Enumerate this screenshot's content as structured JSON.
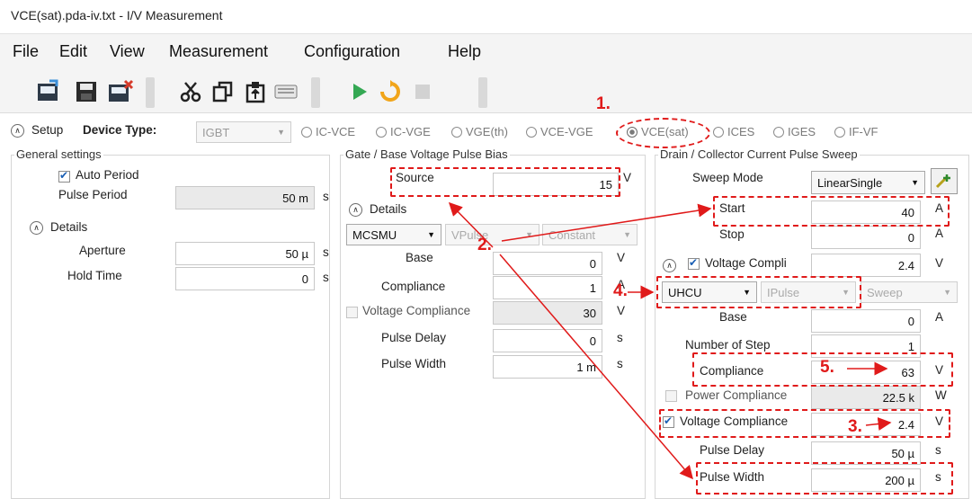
{
  "window": {
    "title": "VCE(sat).pda-iv.txt - I/V Measurement"
  },
  "menu": [
    "File",
    "Edit",
    "View",
    "Measurement",
    "Configuration",
    "Help"
  ],
  "toolbar": {
    "icons": [
      "open-icon",
      "save-icon",
      "new-icon",
      "cut-icon",
      "copy-icon",
      "paste-icon",
      "keyboard-icon",
      "run-icon",
      "repeat-icon",
      "stop-icon"
    ]
  },
  "setup": {
    "label": "Setup",
    "device_type_label": "Device Type:",
    "device_type_value": "IGBT",
    "modes": [
      "IC-VCE",
      "IC-VGE",
      "VGE(th)",
      "VCE-VGE",
      "VCE(sat)",
      "ICES",
      "IGES",
      "IF-VF"
    ],
    "selected_mode": "VCE(sat)"
  },
  "general": {
    "title": "General settings",
    "auto_period_label": "Auto Period",
    "pulse_period_label": "Pulse Period",
    "pulse_period_value": "50 m",
    "pulse_period_unit": "s",
    "details_label": "Details",
    "aperture_label": "Aperture",
    "aperture_value": "50 µ",
    "aperture_unit": "s",
    "hold_time_label": "Hold Time",
    "hold_time_value": "0",
    "hold_time_unit": "s"
  },
  "gate": {
    "title": "Gate / Base Voltage Pulse Bias",
    "source_label": "Source",
    "source_value": "15",
    "source_unit": "V",
    "details_label": "Details",
    "unit_combo": "MCSMU",
    "mode_combo": "VPulse",
    "sweep_combo": "Constant",
    "base_label": "Base",
    "base_value": "0",
    "base_unit": "V",
    "compliance_label": "Compliance",
    "compliance_value": "1",
    "compliance_unit": "A",
    "vcomp_label": "Voltage Compliance",
    "vcomp_value": "30",
    "vcomp_unit": "V",
    "pulse_delay_label": "Pulse Delay",
    "pulse_delay_value": "0",
    "pulse_delay_unit": "s",
    "pulse_width_label": "Pulse Width",
    "pulse_width_value": "1 m",
    "pulse_width_unit": "s"
  },
  "drain": {
    "title": "Drain / Collector Current Pulse Sweep",
    "sweep_mode_label": "Sweep Mode",
    "sweep_mode_value": "LinearSingle",
    "start_label": "Start",
    "start_value": "40",
    "start_unit": "A",
    "stop_label": "Stop",
    "stop_value": "0",
    "stop_unit": "A",
    "vcomp_label": "Voltage Compli",
    "vcomp_value": "2.4",
    "vcomp_unit": "V",
    "unit_combo": "UHCU",
    "mode_combo": "IPulse",
    "sweep_combo": "Sweep",
    "base_label": "Base",
    "base_value": "0",
    "base_unit": "A",
    "steps_label": "Number of Step",
    "steps_value": "1",
    "compliance_label": "Compliance",
    "compliance_value": "63",
    "compliance_unit": "V",
    "power_comp_label": "Power Compliance",
    "power_comp_value": "22.5 k",
    "power_comp_unit": "W",
    "vcomp2_label": "Voltage Compliance",
    "vcomp2_value": "2.4",
    "vcomp2_unit": "V",
    "pulse_delay_label": "Pulse Delay",
    "pulse_delay_value": "50 µ",
    "pulse_delay_unit": "s",
    "pulse_width_label": "Pulse Width",
    "pulse_width_value": "200 µ",
    "pulse_width_unit": "s"
  },
  "annotations": {
    "step1": "1.",
    "step2": "2.",
    "step3": "3.",
    "step4": "4.",
    "step5": "5.",
    "color": "#e01a1a"
  }
}
